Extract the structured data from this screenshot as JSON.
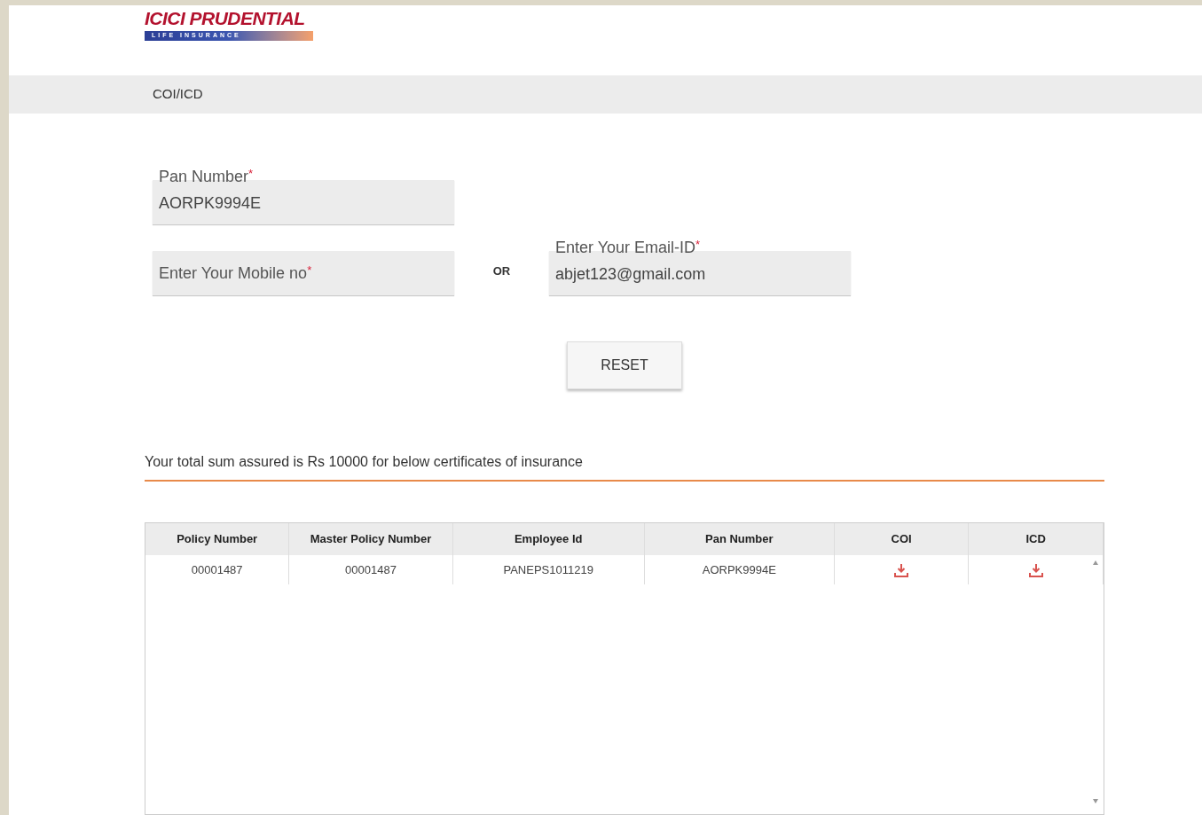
{
  "logo": {
    "brand": "ICICI PRUDENTIAL",
    "tagline": "LIFE INSURANCE"
  },
  "header_bar": {
    "title": "COI/ICD"
  },
  "form": {
    "fields": [
      {
        "label": "Pan Number",
        "required_mark": "*",
        "value": "AORPK9994E"
      },
      {
        "label": "Enter Your Mobile no",
        "required_mark": "*"
      },
      {
        "label": "Enter Your Email-ID",
        "required_mark": "*",
        "value": "abjet123@gmail.com"
      }
    ],
    "separator": "OR",
    "buttons": [
      "RESET"
    ]
  },
  "summary": "Your total sum assured is Rs 10000 for below certificates of insurance",
  "table": {
    "columns": [
      "Policy Number",
      "Master Policy Number",
      "Employee Id",
      "Pan Number",
      "COI",
      "ICD"
    ],
    "rows": [
      {
        "cells": [
          {
            "kind": "text",
            "text": "00001487"
          },
          {
            "kind": "text",
            "text": "00001487"
          },
          {
            "kind": "text",
            "text": "PANEPS1011219"
          },
          {
            "kind": "text",
            "text": "AORPK9994E"
          },
          {
            "kind": "download"
          },
          {
            "kind": "download"
          }
        ]
      }
    ]
  }
}
